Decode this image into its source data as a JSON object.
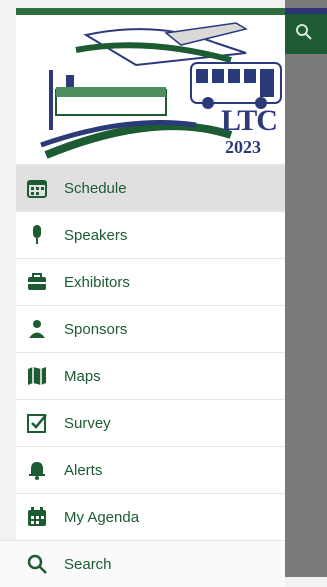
{
  "logo": {
    "text": "LTC",
    "year": "2023"
  },
  "menu": [
    {
      "id": "schedule",
      "label": "Schedule",
      "icon": "calendar-icon",
      "active": true
    },
    {
      "id": "speakers",
      "label": "Speakers",
      "icon": "microphone-icon"
    },
    {
      "id": "exhibitors",
      "label": "Exhibitors",
      "icon": "briefcase-icon"
    },
    {
      "id": "sponsors",
      "label": "Sponsors",
      "icon": "person-icon"
    },
    {
      "id": "maps",
      "label": "Maps",
      "icon": "map-icon"
    },
    {
      "id": "survey",
      "label": "Survey",
      "icon": "checkbox-icon"
    },
    {
      "id": "alerts",
      "label": "Alerts",
      "icon": "bell-icon"
    },
    {
      "id": "agenda",
      "label": "My Agenda",
      "icon": "agenda-calendar-icon"
    },
    {
      "id": "search",
      "label": "Search",
      "icon": "search-icon"
    }
  ],
  "colors": {
    "brand_green": "#1d5b33",
    "brand_blue": "#2d3a7a",
    "overlay": "#7a7a7a"
  }
}
